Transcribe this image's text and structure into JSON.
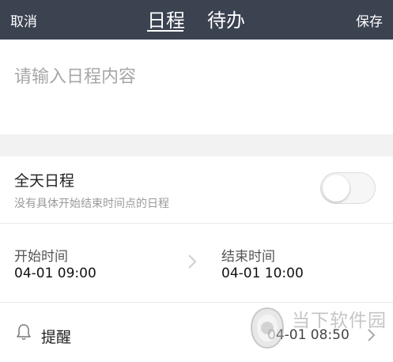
{
  "header": {
    "cancel_label": "取消",
    "save_label": "保存",
    "tabs": [
      {
        "label": "日程",
        "active": true
      },
      {
        "label": "待办",
        "active": false
      }
    ],
    "background": "#3b4250"
  },
  "content": {
    "placeholder": "请输入日程内容",
    "value": ""
  },
  "all_day": {
    "title": "全天日程",
    "subtitle": "没有具体开始结束时间点的日程",
    "enabled": false
  },
  "time": {
    "start_label": "开始时间",
    "start_value": "04-01 09:00",
    "end_label": "结束时间",
    "end_value": "04-01 10:00"
  },
  "reminder": {
    "label": "提醒",
    "value": "04-01 08:50",
    "icon": "bell-icon"
  },
  "watermark": {
    "text": "当下软件园"
  }
}
